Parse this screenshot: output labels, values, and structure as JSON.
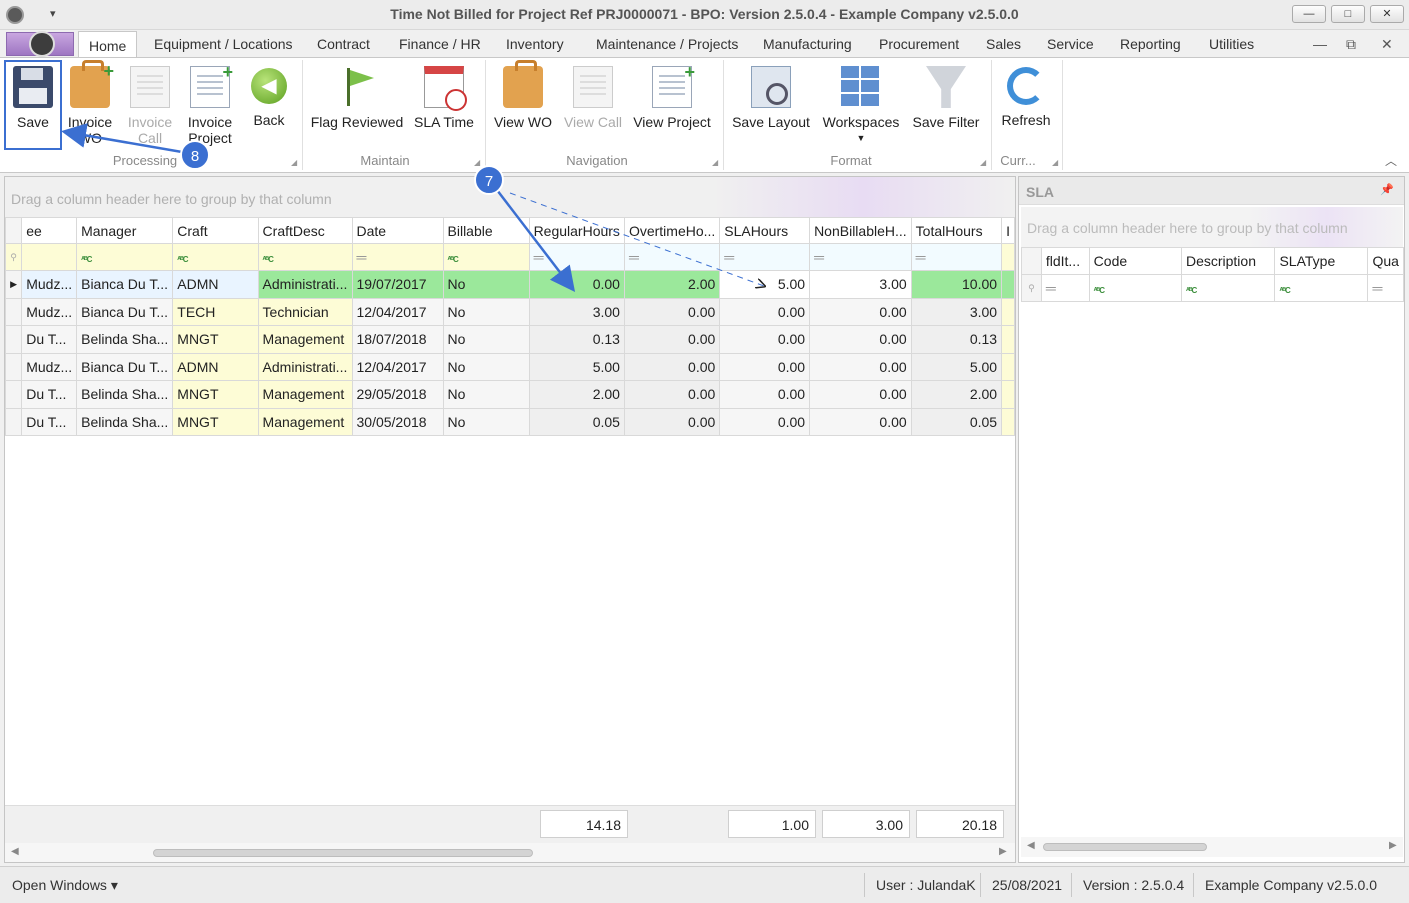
{
  "window": {
    "title": "Time Not Billed for Project Ref PRJ0000071 - BPO: Version 2.5.0.4 - Example Company v2.5.0.0",
    "minimize": "—",
    "maximize": "□",
    "close": "✕",
    "quick_access": "▾"
  },
  "tabs": [
    "Home",
    "Equipment / Locations",
    "Contract",
    "Finance / HR",
    "Inventory",
    "Maintenance / Projects",
    "Manufacturing",
    "Procurement",
    "Sales",
    "Service",
    "Reporting",
    "Utilities"
  ],
  "mdi_controls": [
    "—",
    "⧉",
    "✕"
  ],
  "ribbon": {
    "save": "Save",
    "invoice_wo_1": "Invoice",
    "invoice_wo_2": "WO",
    "invoice_call_1": "Invoice",
    "invoice_call_2": "Call",
    "invoice_project_1": "Invoice",
    "invoice_project_2": "Project",
    "back": "Back",
    "flag_reviewed": "Flag Reviewed",
    "sla_time": "SLA Time",
    "view_wo": "View WO",
    "view_call": "View Call",
    "view_project": "View Project",
    "save_layout": "Save Layout",
    "workspaces": "Workspaces",
    "save_filter": "Save Filter",
    "refresh": "Refresh",
    "groups": {
      "processing": "Processing",
      "maintain": "Maintain",
      "navigation": "Navigation",
      "format": "Format",
      "curr": "Curr..."
    }
  },
  "grid": {
    "group_hint": "Drag a column header here to group by that column",
    "columns": [
      "ee",
      "Manager",
      "Craft",
      "CraftDesc",
      "Date",
      "Billable",
      "RegularHours",
      "OvertimeHo...",
      "SLAHours",
      "NonBillableH...",
      "TotalHours",
      "I"
    ],
    "filter_abc": "ᴬᴮC",
    "filter_eq": "═",
    "rows": [
      {
        "ee": "Mudz...",
        "manager": "Bianca Du T...",
        "craft": "ADMN",
        "craftdesc": "Administrati...",
        "date": "19/07/2017",
        "billable": "No",
        "regular": "0.00",
        "overtime": "2.00",
        "sla": "5.00",
        "nonbillable": "3.00",
        "total": "10.00"
      },
      {
        "ee": "Mudz...",
        "manager": "Bianca Du T...",
        "craft": "TECH",
        "craftdesc": "Technician",
        "date": "12/04/2017",
        "billable": "No",
        "regular": "3.00",
        "overtime": "0.00",
        "sla": "0.00",
        "nonbillable": "0.00",
        "total": "3.00"
      },
      {
        "ee": "Du T...",
        "manager": "Belinda Sha...",
        "craft": "MNGT",
        "craftdesc": "Management",
        "date": "18/07/2018",
        "billable": "No",
        "regular": "0.13",
        "overtime": "0.00",
        "sla": "0.00",
        "nonbillable": "0.00",
        "total": "0.13"
      },
      {
        "ee": "Mudz...",
        "manager": "Bianca Du T...",
        "craft": "ADMN",
        "craftdesc": "Administrati...",
        "date": "12/04/2017",
        "billable": "No",
        "regular": "5.00",
        "overtime": "0.00",
        "sla": "0.00",
        "nonbillable": "0.00",
        "total": "5.00"
      },
      {
        "ee": "Du T...",
        "manager": "Belinda Sha...",
        "craft": "MNGT",
        "craftdesc": "Management",
        "date": "29/05/2018",
        "billable": "No",
        "regular": "2.00",
        "overtime": "0.00",
        "sla": "0.00",
        "nonbillable": "0.00",
        "total": "2.00"
      },
      {
        "ee": "Du T...",
        "manager": "Belinda Sha...",
        "craft": "MNGT",
        "craftdesc": "Management",
        "date": "30/05/2018",
        "billable": "No",
        "regular": "0.05",
        "overtime": "0.00",
        "sla": "0.00",
        "nonbillable": "0.00",
        "total": "0.05"
      }
    ],
    "totals": {
      "regular": "14.18",
      "sla": "1.00",
      "nonbillable": "3.00",
      "total": "20.18"
    }
  },
  "sla": {
    "title": "SLA",
    "pin": "📌",
    "group_hint": "Drag a column header here to group by that column",
    "columns": [
      "fldIt...",
      "Code",
      "Description",
      "SLAType",
      "Qua"
    ]
  },
  "status": {
    "open_windows": "Open Windows ▾",
    "user": "User : JulandaK",
    "date": "25/08/2021",
    "version": "Version : 2.5.0.4",
    "company": "Example Company v2.5.0.0"
  },
  "annotations": {
    "badge_7": "7",
    "badge_8": "8"
  },
  "colors": {
    "selected_row": "#9be89b",
    "annotation": "#3b6fd1",
    "filter_bg": "#fdfcd6"
  }
}
